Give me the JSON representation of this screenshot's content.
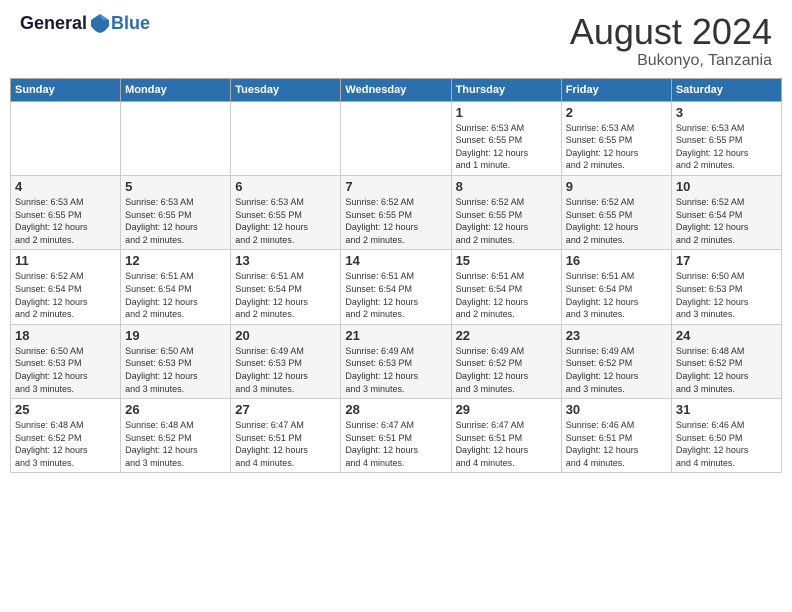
{
  "header": {
    "logo_general": "General",
    "logo_blue": "Blue",
    "month_year": "August 2024",
    "location": "Bukonyo, Tanzania"
  },
  "calendar": {
    "days_of_week": [
      "Sunday",
      "Monday",
      "Tuesday",
      "Wednesday",
      "Thursday",
      "Friday",
      "Saturday"
    ],
    "weeks": [
      [
        {
          "day": "",
          "info": ""
        },
        {
          "day": "",
          "info": ""
        },
        {
          "day": "",
          "info": ""
        },
        {
          "day": "",
          "info": ""
        },
        {
          "day": "1",
          "info": "Sunrise: 6:53 AM\nSunset: 6:55 PM\nDaylight: 12 hours\nand 1 minute."
        },
        {
          "day": "2",
          "info": "Sunrise: 6:53 AM\nSunset: 6:55 PM\nDaylight: 12 hours\nand 2 minutes."
        },
        {
          "day": "3",
          "info": "Sunrise: 6:53 AM\nSunset: 6:55 PM\nDaylight: 12 hours\nand 2 minutes."
        }
      ],
      [
        {
          "day": "4",
          "info": "Sunrise: 6:53 AM\nSunset: 6:55 PM\nDaylight: 12 hours\nand 2 minutes."
        },
        {
          "day": "5",
          "info": "Sunrise: 6:53 AM\nSunset: 6:55 PM\nDaylight: 12 hours\nand 2 minutes."
        },
        {
          "day": "6",
          "info": "Sunrise: 6:53 AM\nSunset: 6:55 PM\nDaylight: 12 hours\nand 2 minutes."
        },
        {
          "day": "7",
          "info": "Sunrise: 6:52 AM\nSunset: 6:55 PM\nDaylight: 12 hours\nand 2 minutes."
        },
        {
          "day": "8",
          "info": "Sunrise: 6:52 AM\nSunset: 6:55 PM\nDaylight: 12 hours\nand 2 minutes."
        },
        {
          "day": "9",
          "info": "Sunrise: 6:52 AM\nSunset: 6:55 PM\nDaylight: 12 hours\nand 2 minutes."
        },
        {
          "day": "10",
          "info": "Sunrise: 6:52 AM\nSunset: 6:54 PM\nDaylight: 12 hours\nand 2 minutes."
        }
      ],
      [
        {
          "day": "11",
          "info": "Sunrise: 6:52 AM\nSunset: 6:54 PM\nDaylight: 12 hours\nand 2 minutes."
        },
        {
          "day": "12",
          "info": "Sunrise: 6:51 AM\nSunset: 6:54 PM\nDaylight: 12 hours\nand 2 minutes."
        },
        {
          "day": "13",
          "info": "Sunrise: 6:51 AM\nSunset: 6:54 PM\nDaylight: 12 hours\nand 2 minutes."
        },
        {
          "day": "14",
          "info": "Sunrise: 6:51 AM\nSunset: 6:54 PM\nDaylight: 12 hours\nand 2 minutes."
        },
        {
          "day": "15",
          "info": "Sunrise: 6:51 AM\nSunset: 6:54 PM\nDaylight: 12 hours\nand 2 minutes."
        },
        {
          "day": "16",
          "info": "Sunrise: 6:51 AM\nSunset: 6:54 PM\nDaylight: 12 hours\nand 3 minutes."
        },
        {
          "day": "17",
          "info": "Sunrise: 6:50 AM\nSunset: 6:53 PM\nDaylight: 12 hours\nand 3 minutes."
        }
      ],
      [
        {
          "day": "18",
          "info": "Sunrise: 6:50 AM\nSunset: 6:53 PM\nDaylight: 12 hours\nand 3 minutes."
        },
        {
          "day": "19",
          "info": "Sunrise: 6:50 AM\nSunset: 6:53 PM\nDaylight: 12 hours\nand 3 minutes."
        },
        {
          "day": "20",
          "info": "Sunrise: 6:49 AM\nSunset: 6:53 PM\nDaylight: 12 hours\nand 3 minutes."
        },
        {
          "day": "21",
          "info": "Sunrise: 6:49 AM\nSunset: 6:53 PM\nDaylight: 12 hours\nand 3 minutes."
        },
        {
          "day": "22",
          "info": "Sunrise: 6:49 AM\nSunset: 6:52 PM\nDaylight: 12 hours\nand 3 minutes."
        },
        {
          "day": "23",
          "info": "Sunrise: 6:49 AM\nSunset: 6:52 PM\nDaylight: 12 hours\nand 3 minutes."
        },
        {
          "day": "24",
          "info": "Sunrise: 6:48 AM\nSunset: 6:52 PM\nDaylight: 12 hours\nand 3 minutes."
        }
      ],
      [
        {
          "day": "25",
          "info": "Sunrise: 6:48 AM\nSunset: 6:52 PM\nDaylight: 12 hours\nand 3 minutes."
        },
        {
          "day": "26",
          "info": "Sunrise: 6:48 AM\nSunset: 6:52 PM\nDaylight: 12 hours\nand 3 minutes."
        },
        {
          "day": "27",
          "info": "Sunrise: 6:47 AM\nSunset: 6:51 PM\nDaylight: 12 hours\nand 4 minutes."
        },
        {
          "day": "28",
          "info": "Sunrise: 6:47 AM\nSunset: 6:51 PM\nDaylight: 12 hours\nand 4 minutes."
        },
        {
          "day": "29",
          "info": "Sunrise: 6:47 AM\nSunset: 6:51 PM\nDaylight: 12 hours\nand 4 minutes."
        },
        {
          "day": "30",
          "info": "Sunrise: 6:46 AM\nSunset: 6:51 PM\nDaylight: 12 hours\nand 4 minutes."
        },
        {
          "day": "31",
          "info": "Sunrise: 6:46 AM\nSunset: 6:50 PM\nDaylight: 12 hours\nand 4 minutes."
        }
      ]
    ]
  }
}
